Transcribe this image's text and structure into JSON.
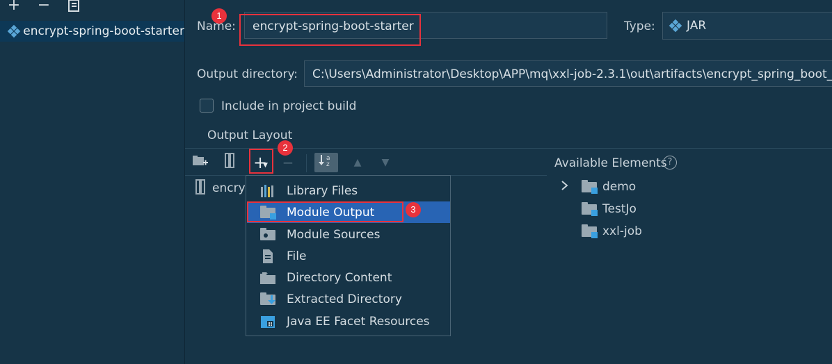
{
  "toolbar": {
    "add": "+",
    "remove": "−",
    "copy": "copy"
  },
  "artifacts": [
    {
      "label": "encrypt-spring-boot-starter"
    }
  ],
  "form": {
    "name_label": "Name:",
    "name_value": "encrypt-spring-boot-starter",
    "type_label": "Type:",
    "type_value": "JAR",
    "output_dir_label": "Output directory:",
    "output_dir_value": "C:\\Users\\Administrator\\Desktop\\APP\\mq\\xxl-job-2.3.1\\out\\artifacts\\encrypt_spring_boot_starter_jar",
    "include_label": "Include in project build",
    "include_checked": false
  },
  "output_layout": {
    "title": "Output Layout",
    "root_item": "encrypt"
  },
  "menu": {
    "items": [
      {
        "label": "Library Files",
        "icon": "library-icon",
        "selected": false
      },
      {
        "label": "Module Output",
        "icon": "module-output-icon",
        "selected": true
      },
      {
        "label": "Module Sources",
        "icon": "module-sources-icon",
        "selected": false
      },
      {
        "label": "File",
        "icon": "file-icon",
        "selected": false
      },
      {
        "label": "Directory Content",
        "icon": "directory-icon",
        "selected": false
      },
      {
        "label": "Extracted Directory",
        "icon": "extracted-directory-icon",
        "selected": false
      },
      {
        "label": "Java EE Facet Resources",
        "icon": "javaee-icon",
        "selected": false
      }
    ]
  },
  "available": {
    "title": "Available Elements",
    "items": [
      {
        "label": "demo",
        "expandable": true
      },
      {
        "label": "TestJo",
        "expandable": false
      },
      {
        "label": "xxl-job",
        "expandable": false
      }
    ]
  },
  "annotations": {
    "badge1": "1",
    "badge2": "2",
    "badge3": "3"
  },
  "colors": {
    "background": "#163447",
    "selection": "#2864b4",
    "annotation": "#e8323c",
    "module_blue": "#3aa0e0"
  }
}
